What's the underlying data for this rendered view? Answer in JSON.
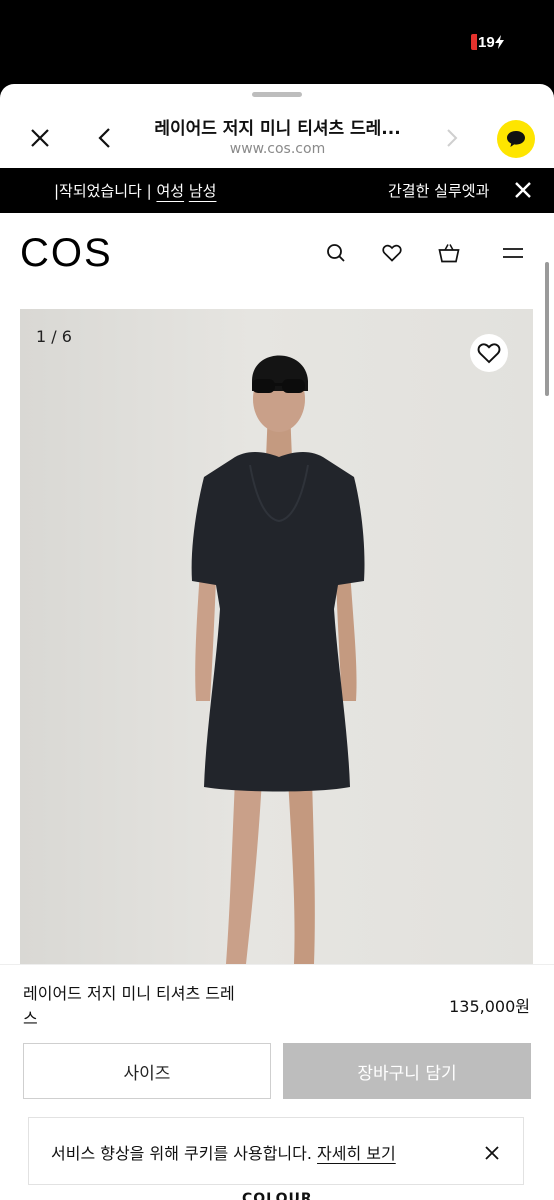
{
  "status": {
    "battery": "19"
  },
  "browser": {
    "title": "레이어드 저지 미니 티셔츠 드레...",
    "url": "www.cos.com"
  },
  "promo": {
    "left_text": "|작되었습니다 | ",
    "women": "여성",
    "men": "남성",
    "right_text": "간결한 실루엣과"
  },
  "header": {
    "logo": "COS"
  },
  "gallery": {
    "counter": "1 / 6"
  },
  "product": {
    "name": "레이어드 저지 미니 티셔츠 드레스",
    "price": "135,000원",
    "size_label": "사이즈",
    "cart_label": "장바구니 담기"
  },
  "cookie": {
    "text": "서비스 향상을 위해 쿠키를 사용합니다. ",
    "link": "자세히 보기"
  },
  "next_section": {
    "label": "COLOUR"
  },
  "colors": {
    "kakao_yellow": "#FEE500",
    "battery_red": "#E5322D",
    "cart_disabled": "#BDBDBD",
    "dress": "#22252b"
  }
}
